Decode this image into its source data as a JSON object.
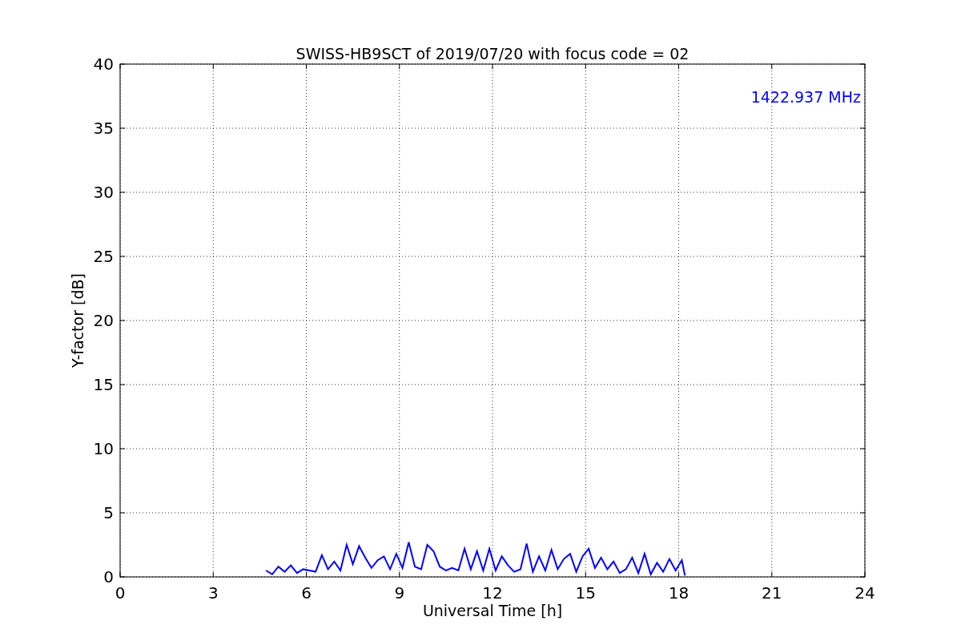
{
  "chart_data": {
    "type": "line",
    "title": "SWISS-HB9SCT of 2019/07/20 with focus code = 02",
    "xlabel": "Universal Time [h]",
    "ylabel": "Y-factor [dB]",
    "xlim": [
      0,
      24
    ],
    "ylim": [
      0,
      40
    ],
    "xticks": [
      0,
      3,
      6,
      9,
      12,
      15,
      18,
      21,
      24
    ],
    "yticks": [
      0,
      5,
      10,
      15,
      20,
      25,
      30,
      35,
      40
    ],
    "x": [
      4.7,
      4.9,
      5.1,
      5.3,
      5.5,
      5.7,
      5.9,
      6.1,
      6.3,
      6.5,
      6.7,
      6.9,
      7.1,
      7.3,
      7.5,
      7.7,
      7.9,
      8.1,
      8.3,
      8.5,
      8.7,
      8.9,
      9.1,
      9.3,
      9.5,
      9.7,
      9.9,
      10.1,
      10.3,
      10.5,
      10.7,
      10.9,
      11.1,
      11.3,
      11.5,
      11.7,
      11.9,
      12.1,
      12.3,
      12.5,
      12.7,
      12.9,
      13.1,
      13.3,
      13.5,
      13.7,
      13.9,
      14.1,
      14.3,
      14.5,
      14.7,
      14.9,
      15.1,
      15.3,
      15.5,
      15.7,
      15.9,
      16.1,
      16.3,
      16.5,
      16.7,
      16.9,
      17.1,
      17.3,
      17.5,
      17.7,
      17.9,
      18.1,
      18.2
    ],
    "series": [
      {
        "name": "1422.937 MHz",
        "color": "#0000ff",
        "values": [
          0.5,
          0.2,
          0.8,
          0.4,
          0.9,
          0.3,
          0.6,
          0.5,
          0.4,
          1.7,
          0.6,
          1.2,
          0.5,
          2.5,
          1.0,
          2.4,
          1.5,
          0.7,
          1.3,
          1.6,
          0.6,
          1.8,
          0.7,
          2.7,
          0.8,
          0.6,
          2.5,
          2.0,
          0.8,
          0.5,
          0.7,
          0.5,
          2.2,
          0.6,
          2.0,
          0.5,
          2.2,
          0.5,
          1.6,
          0.9,
          0.4,
          0.6,
          2.6,
          0.4,
          1.6,
          0.5,
          2.1,
          0.6,
          1.4,
          1.8,
          0.4,
          1.6,
          2.2,
          0.7,
          1.5,
          0.6,
          1.2,
          0.3,
          0.6,
          1.5,
          0.3,
          1.8,
          0.2,
          1.1,
          0.4,
          1.4,
          0.5,
          1.3,
          0.1
        ]
      }
    ],
    "grid": true
  }
}
